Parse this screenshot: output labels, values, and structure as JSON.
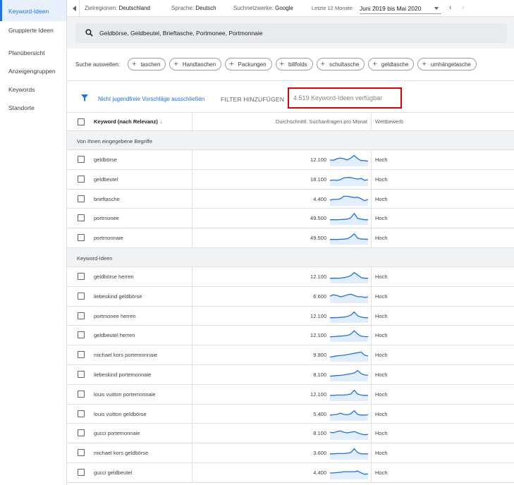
{
  "sidebar": {
    "items": [
      {
        "label": "Keyword-Ideen",
        "active": true
      },
      {
        "label": "Gruppierte Ideen",
        "active": false
      },
      {
        "label": "Planübersicht",
        "active": false
      },
      {
        "label": "Anzeigengruppen",
        "active": false
      },
      {
        "label": "Keywords",
        "active": false
      },
      {
        "label": "Standorte",
        "active": false
      }
    ]
  },
  "topbar": {
    "regions_label": "Zielregionen:",
    "regions_value": "Deutschland",
    "language_label": "Sprache:",
    "language_value": "Deutsch",
    "networks_label": "Suchnetzwerke:",
    "networks_value": "Google",
    "period_label": "Letzte 12 Monate",
    "period_value": "Juni 2019 bis Mai 2020"
  },
  "search": {
    "query": "Geldbörse, Geldbeutel, Brieftasche, Portmonee, Portmonnaie"
  },
  "expand": {
    "label": "Suche ausweiten:",
    "chips": [
      "taschen",
      "Handtaschen",
      "Packungen",
      "billfolds",
      "schultasche",
      "geldtasche",
      "umhängetasche"
    ]
  },
  "filter": {
    "link": "Nicht jugendfreie Vorschläge ausschließen",
    "add": "FILTER HINZUFÜGEN",
    "count": "4.519 Keyword-Ideen verfügbar"
  },
  "table": {
    "col_keyword": "Keyword (nach Relevanz)",
    "col_volume": "Durchschnittl. Suchanfragen pro Monat",
    "col_competition": "Wettbewerb",
    "group_provided": "Von Ihnen eingegebene Begriffe",
    "group_ideas": "Keyword-Ideen",
    "accent_color": "#1a73e8",
    "highlight_color": "#e00000",
    "provided": [
      {
        "keyword": "geldbörse",
        "volume": "12.100",
        "competition": "Hoch",
        "trend": [
          0.45,
          0.42,
          0.55,
          0.6,
          0.55,
          0.45,
          0.6,
          0.8,
          0.55,
          0.4,
          0.4,
          0.35
        ]
      },
      {
        "keyword": "geldbeutel",
        "volume": "18.100",
        "competition": "Hoch",
        "trend": [
          0.4,
          0.42,
          0.4,
          0.45,
          0.6,
          0.62,
          0.62,
          0.55,
          0.5,
          0.55,
          0.4,
          0.45
        ]
      },
      {
        "keyword": "brieftasche",
        "volume": "4.400",
        "competition": "Hoch",
        "trend": [
          0.4,
          0.45,
          0.45,
          0.5,
          0.7,
          0.7,
          0.65,
          0.6,
          0.62,
          0.5,
          0.35,
          0.45
        ]
      },
      {
        "keyword": "portmonee",
        "volume": "49.500",
        "competition": "Hoch",
        "trend": [
          0.35,
          0.35,
          0.35,
          0.36,
          0.38,
          0.4,
          0.5,
          0.85,
          0.45,
          0.4,
          0.35,
          0.35
        ]
      },
      {
        "keyword": "portmonnaie",
        "volume": "49.500",
        "competition": "Hoch",
        "trend": [
          0.35,
          0.35,
          0.35,
          0.36,
          0.38,
          0.4,
          0.55,
          0.8,
          0.45,
          0.38,
          0.38,
          0.35
        ]
      }
    ],
    "ideas": [
      {
        "keyword": "geldbörse herren",
        "volume": "12.100",
        "competition": "Hoch",
        "trend": [
          0.35,
          0.35,
          0.35,
          0.36,
          0.4,
          0.45,
          0.55,
          0.8,
          0.6,
          0.4,
          0.35,
          0.35
        ]
      },
      {
        "keyword": "liebeskind geldbörse",
        "volume": "6.600",
        "competition": "Hoch",
        "trend": [
          0.5,
          0.6,
          0.55,
          0.45,
          0.5,
          0.6,
          0.65,
          0.55,
          0.45,
          0.45,
          0.4,
          0.42
        ]
      },
      {
        "keyword": "portmonee herren",
        "volume": "12.100",
        "competition": "Hoch",
        "trend": [
          0.35,
          0.35,
          0.36,
          0.38,
          0.4,
          0.45,
          0.55,
          0.8,
          0.5,
          0.4,
          0.35,
          0.35
        ]
      },
      {
        "keyword": "geldbeutel herren",
        "volume": "12.100",
        "competition": "Hoch",
        "trend": [
          0.35,
          0.36,
          0.38,
          0.4,
          0.42,
          0.45,
          0.55,
          0.82,
          0.55,
          0.4,
          0.36,
          0.35
        ]
      },
      {
        "keyword": "michael kors portemonnaie",
        "volume": "9.900",
        "competition": "Hoch",
        "trend": [
          0.3,
          0.35,
          0.4,
          0.42,
          0.45,
          0.5,
          0.55,
          0.6,
          0.65,
          0.7,
          0.45,
          0.4
        ]
      },
      {
        "keyword": "liebeskind portemonnaie",
        "volume": "8.100",
        "competition": "Hoch",
        "trend": [
          0.35,
          0.38,
          0.4,
          0.42,
          0.45,
          0.5,
          0.55,
          0.6,
          0.8,
          0.55,
          0.45,
          0.42
        ]
      },
      {
        "keyword": "louis vuitton portemonnaie",
        "volume": "12.100",
        "competition": "Hoch",
        "trend": [
          0.4,
          0.4,
          0.42,
          0.42,
          0.42,
          0.45,
          0.5,
          0.8,
          0.5,
          0.42,
          0.4,
          0.4
        ]
      },
      {
        "keyword": "louis vuitton geldbörse",
        "volume": "5.400",
        "competition": "Hoch",
        "trend": [
          0.4,
          0.42,
          0.45,
          0.55,
          0.45,
          0.42,
          0.5,
          0.75,
          0.45,
          0.4,
          0.4,
          0.42
        ]
      },
      {
        "keyword": "gucci portemonnaie",
        "volume": "8.100",
        "competition": "Hoch",
        "trend": [
          0.55,
          0.5,
          0.6,
          0.65,
          0.55,
          0.5,
          0.55,
          0.6,
          0.5,
          0.4,
          0.35,
          0.38
        ]
      },
      {
        "keyword": "michael kors geldbörse",
        "volume": "3.600",
        "competition": "Hoch",
        "trend": [
          0.4,
          0.4,
          0.42,
          0.42,
          0.42,
          0.45,
          0.5,
          0.8,
          0.5,
          0.4,
          0.4,
          0.4
        ]
      },
      {
        "keyword": "gucci geldbeutel",
        "volume": "4.400",
        "competition": "Hoch",
        "trend": [
          0.45,
          0.45,
          0.48,
          0.5,
          0.55,
          0.55,
          0.55,
          0.55,
          0.6,
          0.45,
          0.35,
          0.38
        ]
      }
    ]
  }
}
